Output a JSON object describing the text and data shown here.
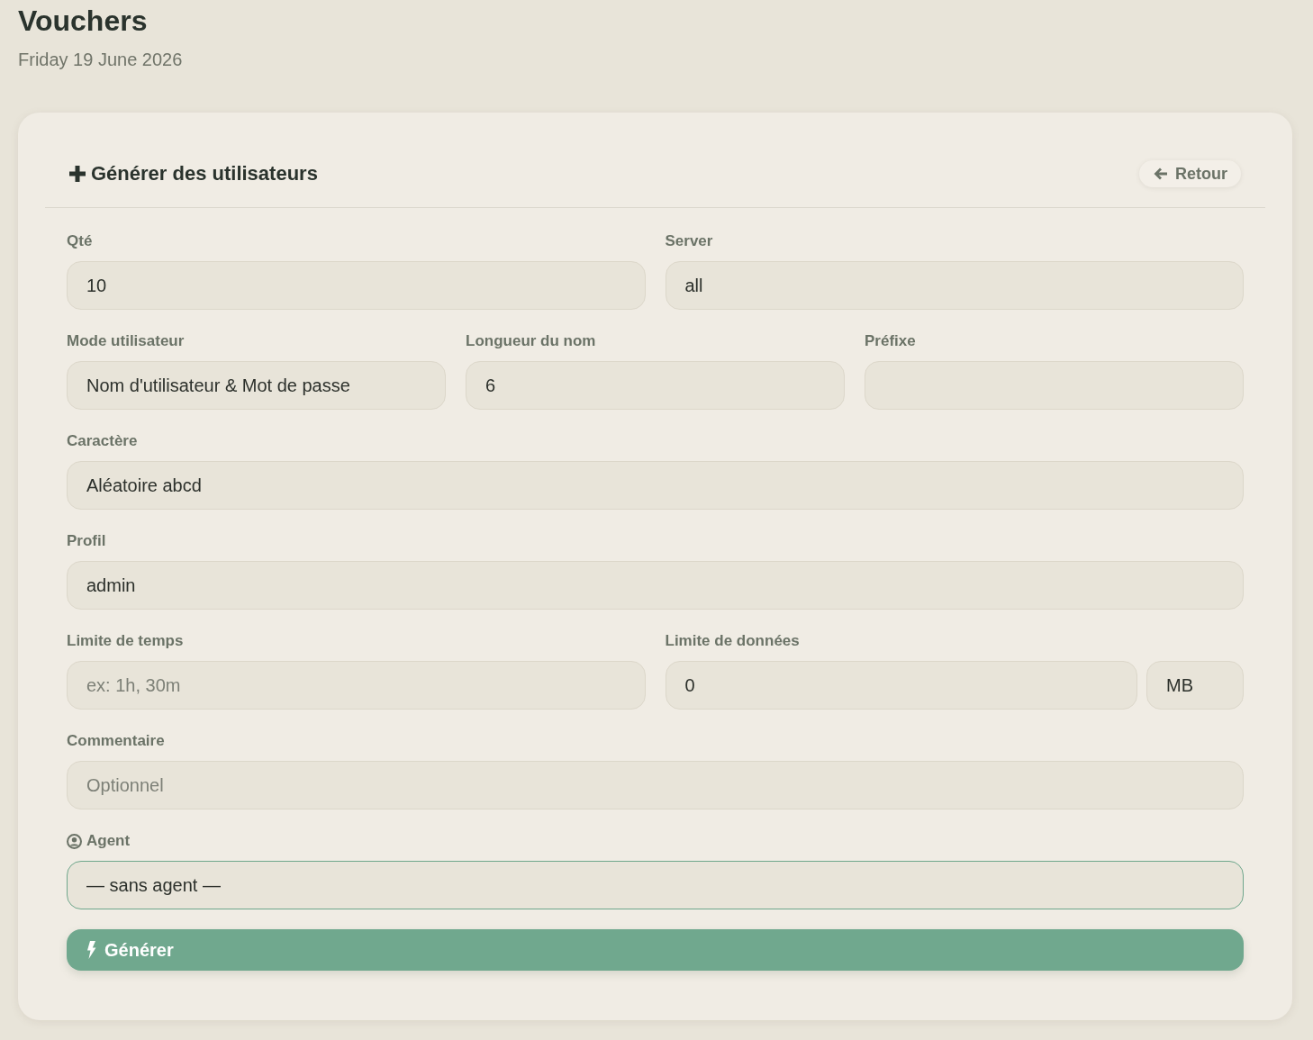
{
  "page": {
    "title": "Vouchers",
    "date": "Friday 19 June 2026"
  },
  "card": {
    "title": "Générer des utilisateurs",
    "back_button": {
      "label": "Retour"
    }
  },
  "form": {
    "rows": [
      {
        "fields": [
          {
            "kind": "plain",
            "label": "Qté",
            "value": "10",
            "focused": false
          },
          {
            "kind": "plain",
            "label": "Server",
            "value": "all",
            "focused": false
          }
        ]
      },
      {
        "fields": [
          {
            "kind": "plain",
            "label": "Mode utilisateur",
            "value": "Nom d'utilisateur & Mot de passe",
            "focused": false
          },
          {
            "kind": "plain",
            "label": "Longueur du nom",
            "value": "6",
            "focused": false
          },
          {
            "kind": "plain",
            "label": "Préfixe",
            "focused": false
          }
        ]
      },
      {
        "fields": [
          {
            "kind": "plain",
            "label": "Caractère",
            "value": "Aléatoire abcd",
            "focused": false
          }
        ]
      },
      {
        "fields": [
          {
            "kind": "plain",
            "label": "Profil",
            "value": "admin",
            "focused": false
          }
        ]
      },
      {
        "fields": [
          {
            "kind": "plain",
            "label": "Limite de temps",
            "placeholder": "ex: 1h, 30m",
            "focused": false
          },
          {
            "kind": "unit",
            "label": "Limite de données",
            "value": "0",
            "unit": "MB",
            "focused": false
          }
        ]
      },
      {
        "fields": [
          {
            "kind": "plain",
            "label": "Commentaire",
            "placeholder": "Optionnel",
            "focused": false
          }
        ]
      },
      {
        "fields": [
          {
            "kind": "person",
            "label": "Agent",
            "value": "— sans agent —",
            "focused": true
          }
        ]
      }
    ],
    "submit_button": {
      "label": "Générer"
    }
  }
}
